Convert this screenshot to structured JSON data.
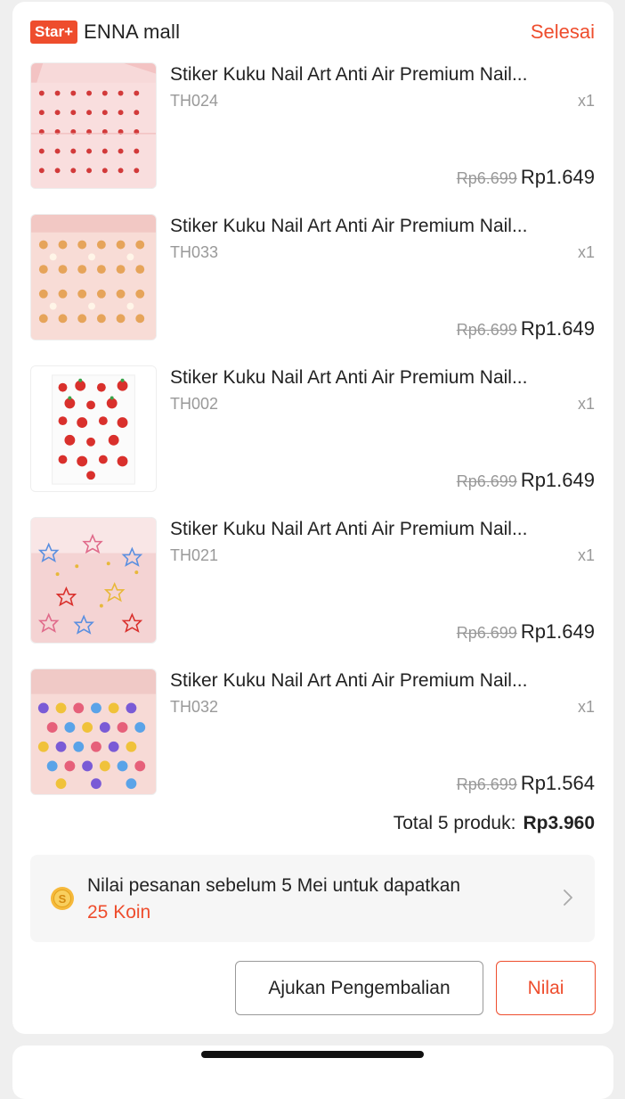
{
  "shop": {
    "badge": "Star+",
    "name": "ENNA mall",
    "status": "Selesai"
  },
  "products": [
    {
      "title": "Stiker Kuku Nail Art Anti Air Premium Nail...",
      "variant": "TH024",
      "qty": "x1",
      "old_price": "Rp6.699",
      "price": "Rp1.649"
    },
    {
      "title": "Stiker Kuku Nail Art Anti Air Premium Nail...",
      "variant": "TH033",
      "qty": "x1",
      "old_price": "Rp6.699",
      "price": "Rp1.649"
    },
    {
      "title": "Stiker Kuku Nail Art Anti Air Premium Nail...",
      "variant": "TH002",
      "qty": "x1",
      "old_price": "Rp6.699",
      "price": "Rp1.649"
    },
    {
      "title": "Stiker Kuku Nail Art Anti Air Premium Nail...",
      "variant": "TH021",
      "qty": "x1",
      "old_price": "Rp6.699",
      "price": "Rp1.649"
    },
    {
      "title": "Stiker Kuku Nail Art Anti Air Premium Nail...",
      "variant": "TH032",
      "qty": "x1",
      "old_price": "Rp6.699",
      "price": "Rp1.564"
    }
  ],
  "total": {
    "label": "Total 5 produk:",
    "value": "Rp3.960"
  },
  "coin_prompt": {
    "text": "Nilai pesanan sebelum 5 Mei untuk dapatkan",
    "reward": "25 Koin",
    "icon": "coin-icon"
  },
  "actions": {
    "return_label": "Ajukan Pengembalian",
    "rate_label": "Nilai"
  },
  "colors": {
    "accent": "#ee4d2d",
    "muted": "#999999",
    "text": "#222222"
  }
}
